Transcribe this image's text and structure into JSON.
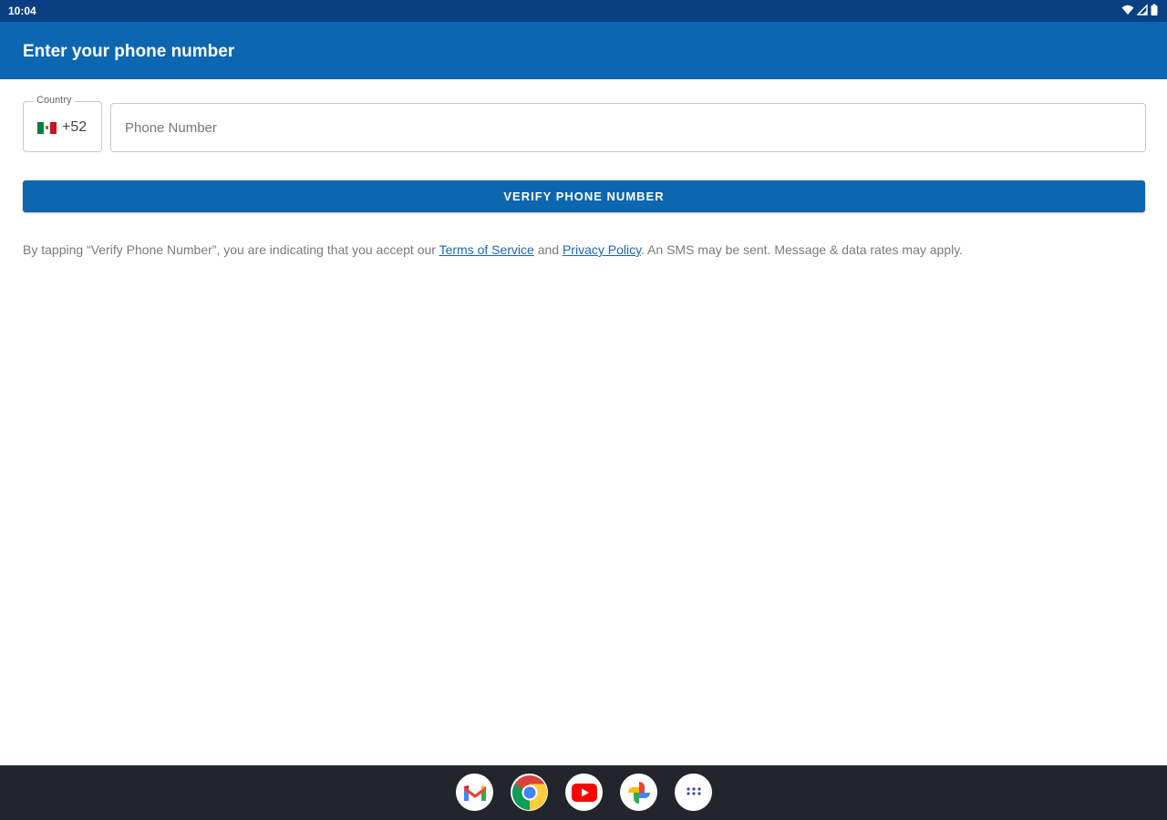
{
  "status_bar": {
    "time": "10:04"
  },
  "app_bar": {
    "title": "Enter your phone number"
  },
  "form": {
    "country_label": "Country",
    "country_code": "+52",
    "phone_placeholder": "Phone Number",
    "phone_value": "",
    "verify_label": "VERIFY PHONE NUMBER"
  },
  "disclaimer": {
    "prefix": "By tapping “Verify Phone Number”, you are indicating that you accept our ",
    "terms_link": "Terms of Service",
    "middle": " and ",
    "privacy_link": "Privacy Policy",
    "suffix": ". An SMS may be sent. Message & data rates may apply."
  },
  "dock": {
    "apps": [
      "gmail-icon",
      "chrome-icon",
      "youtube-icon",
      "photos-icon",
      "app-drawer-icon"
    ]
  },
  "colors": {
    "status_bar": "#0a3f82",
    "primary": "#0d67b0",
    "link": "#1a66b8",
    "dock": "#22252b"
  }
}
